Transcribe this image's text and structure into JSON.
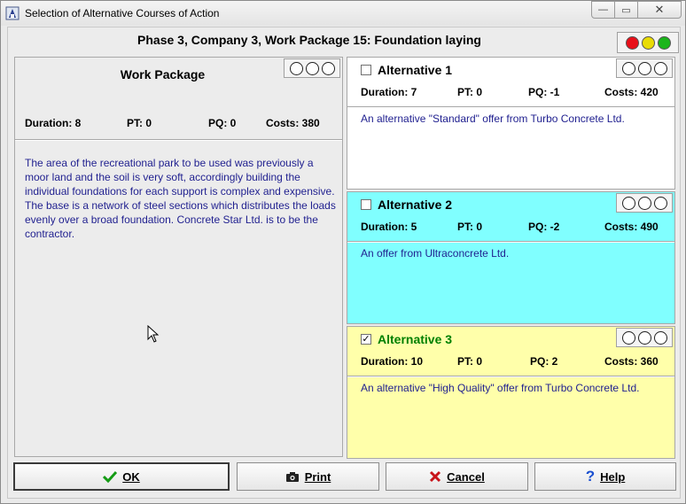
{
  "window": {
    "title": "Selection of Alternative Courses of Action",
    "controls": {
      "minimize": "—",
      "maximize": "▭",
      "close": "✕"
    }
  },
  "header": {
    "title": "Phase 3, Company 3, Work Package 15: Foundation laying",
    "traffic_lights": [
      "#e8101a",
      "#e9dc06",
      "#1bb51b"
    ]
  },
  "work_package": {
    "title": "Work Package",
    "duration": "Duration: 8",
    "pt": "PT: 0",
    "pq": "PQ: 0",
    "costs": "Costs: 380",
    "description": "The area of the recreational park to be used was previously a moor land and the soil is very soft, accordingly building the individual foundations for each support is complex and expensive. The base is a network of steel sections which distributes the loads evenly over a broad foundation. Concrete Star Ltd. is to be the contractor."
  },
  "alternatives": [
    {
      "name": "Alternative 1",
      "checked": false,
      "duration": "Duration: 7",
      "pt": "PT: 0",
      "pq": "PQ: -1",
      "costs": "Costs: 420",
      "description": "An alternative \"Standard\" offer from Turbo Concrete Ltd.",
      "bg": "#ffffff",
      "name_color": "#000000"
    },
    {
      "name": "Alternative 2",
      "checked": false,
      "duration": "Duration: 5",
      "pt": "PT: 0",
      "pq": "PQ: -2",
      "costs": "Costs: 490",
      "description": "An offer from Ultraconcrete Ltd.",
      "bg": "#80ffff",
      "name_color": "#000000"
    },
    {
      "name": "Alternative 3",
      "checked": true,
      "duration": "Duration: 10",
      "pt": "PT: 0",
      "pq": "PQ: 2",
      "costs": "Costs: 360",
      "description": "An alternative \"High Quality\" offer from Turbo Concrete Ltd.",
      "bg": "#ffffaa",
      "name_color": "#008000"
    }
  ],
  "buttons": {
    "ok": {
      "label": "OK",
      "icon": "checkmark-icon"
    },
    "print": {
      "label": "Print",
      "icon": "camera-icon"
    },
    "cancel": {
      "label": "Cancel",
      "icon": "x-icon"
    },
    "help": {
      "label": "Help",
      "icon": "question-icon"
    }
  }
}
